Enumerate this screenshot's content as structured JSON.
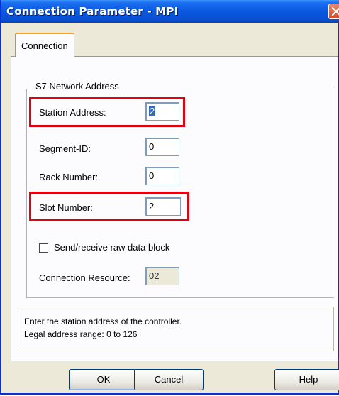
{
  "window": {
    "title": "Connection Parameter - MPI"
  },
  "tabs": [
    {
      "label": "Connection"
    }
  ],
  "group": {
    "title": "S7 Network Address",
    "station_address": {
      "label": "Station Address:",
      "value": "2"
    },
    "segment_id": {
      "label": "Segment-ID:",
      "value": "0"
    },
    "rack_number": {
      "label": "Rack Number:",
      "value": "0"
    },
    "slot_number": {
      "label": "Slot Number:",
      "value": "2"
    },
    "raw_data": {
      "label": "Send/receive raw data block",
      "checked": false
    },
    "connection_resource": {
      "label": "Connection Resource:",
      "value": "02"
    }
  },
  "info": {
    "line1": "Enter the station address of the controller.",
    "line2": "Legal address range: 0 to 126"
  },
  "buttons": {
    "ok": "OK",
    "cancel": "Cancel",
    "help": "Help"
  },
  "highlight_color": "#e3000f"
}
